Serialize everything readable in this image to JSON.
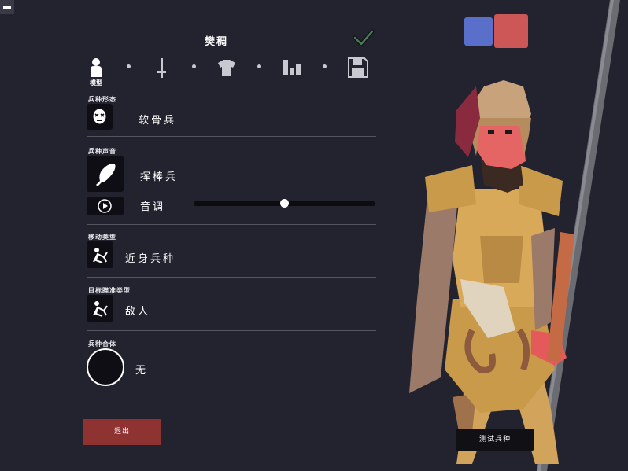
{
  "header": {
    "title": "樊稠"
  },
  "steps": {
    "active_label": "模型"
  },
  "sections": {
    "form": {
      "label": "兵种形态",
      "value": "软骨兵"
    },
    "voice": {
      "label": "兵种声音",
      "value": "挥棒兵",
      "pitch_label": "音调",
      "pitch_level": 0.5
    },
    "movement": {
      "label": "移动类型",
      "value": "近身兵种"
    },
    "targeting": {
      "label": "目标瞄准类型",
      "value": "敌人"
    },
    "fusion": {
      "label": "兵种合体",
      "value": "无"
    }
  },
  "buttons": {
    "exit": "退出",
    "test": "测试兵种"
  },
  "colors": {
    "primary": "#5a6fc9",
    "secondary": "#cd5656",
    "exit": "#8f3232",
    "background": "#23232f"
  },
  "icons": [
    "menu-icon",
    "checkmark-icon",
    "unit-icon",
    "sword-icon",
    "armor-icon",
    "stats-icon",
    "save-icon",
    "skull-face-icon",
    "club-icon",
    "play-icon",
    "collapsed-figure-icon"
  ]
}
